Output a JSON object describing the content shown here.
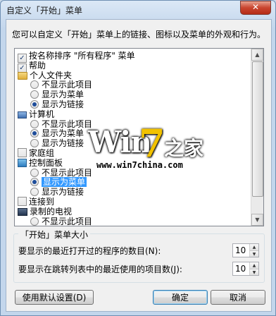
{
  "window": {
    "title": "自定义「开始」菜单",
    "close_label": "✕"
  },
  "description": "您可以自定义「开始」菜单上的链接、图标以及菜单的外观和行为。",
  "tree": [
    {
      "kind": "checkbox",
      "checked": true,
      "label": "按名称排序 \"所有程序\" 菜单"
    },
    {
      "kind": "checkbox",
      "checked": true,
      "label": "帮助"
    },
    {
      "kind": "header",
      "icon": "folder-icon",
      "label": "个人文件夹"
    },
    {
      "kind": "radio",
      "checked": false,
      "label": "不显示此项目"
    },
    {
      "kind": "radio",
      "checked": false,
      "label": "显示为菜单"
    },
    {
      "kind": "radio",
      "checked": true,
      "label": "显示为链接"
    },
    {
      "kind": "header",
      "icon": "computer-icon",
      "label": "计算机"
    },
    {
      "kind": "radio",
      "checked": false,
      "label": "不显示此项目"
    },
    {
      "kind": "radio",
      "checked": true,
      "label": "显示为菜单"
    },
    {
      "kind": "radio",
      "checked": false,
      "label": "显示为链接"
    },
    {
      "kind": "checkbox",
      "checked": false,
      "label": "家庭组"
    },
    {
      "kind": "header",
      "icon": "control-panel-icon",
      "label": "控制面板"
    },
    {
      "kind": "radio",
      "checked": false,
      "label": "不显示此项目"
    },
    {
      "kind": "radio",
      "checked": true,
      "selected": true,
      "label": "显示为菜单"
    },
    {
      "kind": "radio",
      "checked": false,
      "label": "显示为链接"
    },
    {
      "kind": "checkbox",
      "checked": false,
      "label": "连接到"
    },
    {
      "kind": "header",
      "icon": "tv-icon",
      "label": "录制的电视"
    },
    {
      "kind": "radio",
      "checked": false,
      "label": "不显示此项目"
    }
  ],
  "watermark": {
    "win": "Win",
    "seven": "7",
    "home": "之家",
    "url": "www.win7china.com"
  },
  "size_group": {
    "title": "「开始」菜单大小",
    "recent_programs_label": "要显示的最近打开过的程序的数目(N):",
    "recent_programs_value": "10",
    "jump_list_label": "要显示在跳转列表中的最近使用的项目数(J):",
    "jump_list_value": "10"
  },
  "buttons": {
    "defaults": "使用默认设置(D)",
    "ok": "确定",
    "cancel": "取消"
  }
}
